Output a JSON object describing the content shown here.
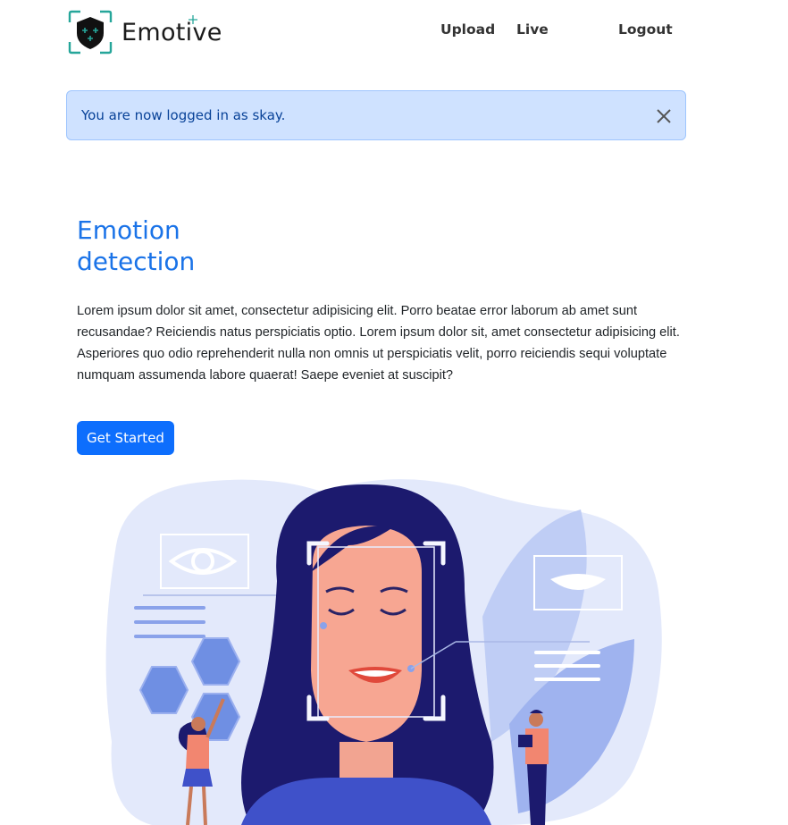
{
  "nav": {
    "brand": "Emotive",
    "links": [
      "Upload",
      "Live",
      "Logout"
    ]
  },
  "alert": {
    "message": "You are now logged in as skay."
  },
  "hero": {
    "title_line1": "Emotion",
    "title_line2": "detection",
    "body": "Lorem ipsum dolor sit amet, consectetur adipisicing elit. Porro beatae error laborum ab amet sunt recusandae? Reiciendis natus perspiciatis optio. Lorem ipsum dolor sit, amet consectetur adipisicing elit. Asperiores quo odio reprehenderit nulla non omnis ut perspiciatis velit, porro reiciendis sequi voluptate numquam assumenda labore quaerat! Saepe eveniet at suscipit?",
    "cta_label": "Get Started"
  },
  "colors": {
    "accent": "#1a73e8",
    "button": "#0d6efd",
    "alert_bg": "#cfe2ff",
    "alert_text": "#084298"
  },
  "icons": {
    "brand": "shield-logo-icon",
    "close": "close-icon"
  }
}
